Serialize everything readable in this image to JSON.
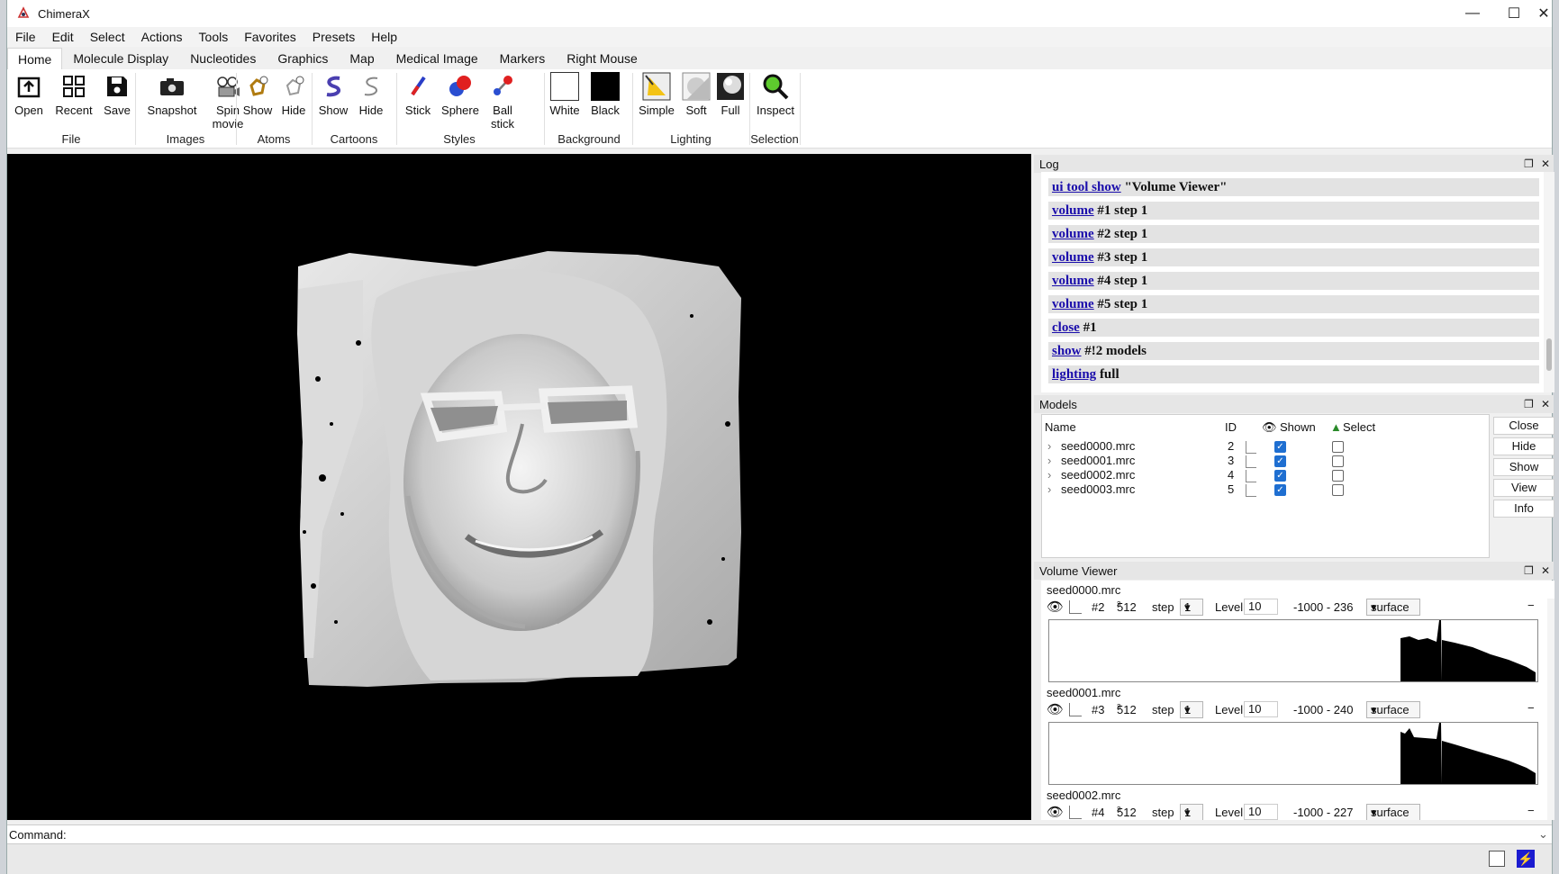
{
  "window": {
    "title": "ChimeraX"
  },
  "menu": [
    "File",
    "Edit",
    "Select",
    "Actions",
    "Tools",
    "Favorites",
    "Presets",
    "Help"
  ],
  "tabs": [
    "Home",
    "Molecule Display",
    "Nucleotides",
    "Graphics",
    "Map",
    "Medical Image",
    "Markers",
    "Right Mouse"
  ],
  "ribbon": {
    "buttons": [
      "Open",
      "Recent",
      "Save",
      "Snapshot",
      "Spin movie",
      "Show",
      "Hide",
      "Show",
      "Hide",
      "Stick",
      "Sphere",
      "Ball stick",
      "White",
      "Black",
      "Simple",
      "Soft",
      "Full",
      "Inspect"
    ],
    "groups": [
      "File",
      "Images",
      "Atoms",
      "Cartoons",
      "Styles",
      "Background",
      "Lighting",
      "Selection"
    ]
  },
  "log": {
    "title": "Log",
    "lines": [
      {
        "cmd": "ui tool show",
        "rest": " \"Volume Viewer\""
      },
      {
        "cmd": "volume",
        "rest": " #1 step 1"
      },
      {
        "cmd": "volume",
        "rest": " #2 step 1"
      },
      {
        "cmd": "volume",
        "rest": " #3 step 1"
      },
      {
        "cmd": "volume",
        "rest": " #4 step 1"
      },
      {
        "cmd": "volume",
        "rest": " #5 step 1"
      },
      {
        "cmd": "close",
        "rest": " #1"
      },
      {
        "cmd": "show",
        "rest": " #!2 models"
      },
      {
        "cmd": "lighting",
        "rest": " full"
      }
    ]
  },
  "models": {
    "title": "Models",
    "headers": {
      "name": "Name",
      "id": "ID",
      "shown": "Shown",
      "select": "Select"
    },
    "rows": [
      {
        "name": "seed0000.mrc",
        "id": "2"
      },
      {
        "name": "seed0001.mrc",
        "id": "3"
      },
      {
        "name": "seed0002.mrc",
        "id": "4"
      },
      {
        "name": "seed0003.mrc",
        "id": "5"
      }
    ],
    "buttons": [
      "Close",
      "Hide",
      "Show",
      "View",
      "Info"
    ]
  },
  "volume_viewer": {
    "title": "Volume Viewer",
    "labels": {
      "step": "step",
      "level": "Level"
    },
    "volumes": [
      {
        "name": "seed0000.mrc",
        "id": "#2",
        "size": "512",
        "step": "1",
        "level": "10",
        "range": "-1000 - 236",
        "style": "surface"
      },
      {
        "name": "seed0001.mrc",
        "id": "#3",
        "size": "512",
        "step": "1",
        "level": "10",
        "range": "-1000 - 240",
        "style": "surface"
      },
      {
        "name": "seed0002.mrc",
        "id": "#4",
        "size": "512",
        "step": "1",
        "level": "10",
        "range": "-1000 - 227",
        "style": "surface"
      }
    ]
  },
  "command": {
    "label": "Command:",
    "value": ""
  }
}
